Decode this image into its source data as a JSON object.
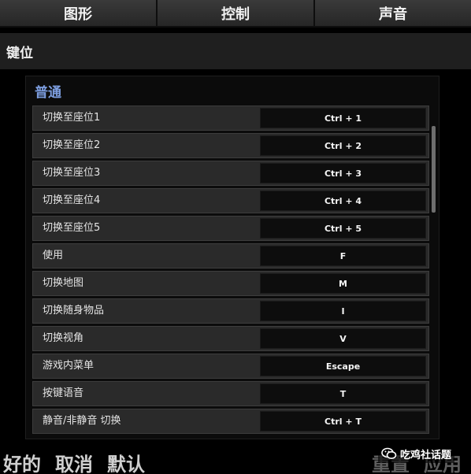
{
  "tabs": [
    "图形",
    "控制",
    "声音"
  ],
  "section": {
    "title": "键位"
  },
  "group": {
    "title": "普通"
  },
  "bindings": [
    {
      "action": "切换至座位1",
      "key": "Ctrl + 1"
    },
    {
      "action": "切换至座位2",
      "key": "Ctrl + 2"
    },
    {
      "action": "切换至座位3",
      "key": "Ctrl + 3"
    },
    {
      "action": "切换至座位4",
      "key": "Ctrl + 4"
    },
    {
      "action": "切换至座位5",
      "key": "Ctrl + 5"
    },
    {
      "action": "使用",
      "key": "F"
    },
    {
      "action": "切换地图",
      "key": "M"
    },
    {
      "action": "切换随身物品",
      "key": "I"
    },
    {
      "action": "切换视角",
      "key": "V"
    },
    {
      "action": "游戏内菜单",
      "key": "Escape"
    },
    {
      "action": "按键语音",
      "key": "T"
    },
    {
      "action": "静音/非静音 切换",
      "key": "Ctrl + T"
    }
  ],
  "footer": {
    "ok": "好的",
    "cancel": "取消",
    "default": "默认",
    "reset": "重置",
    "apply": "应用"
  },
  "watermark": {
    "text": "吃鸡社话题",
    "icon": "wechat-icon"
  },
  "colors": {
    "accent": "#7d9ee0"
  }
}
